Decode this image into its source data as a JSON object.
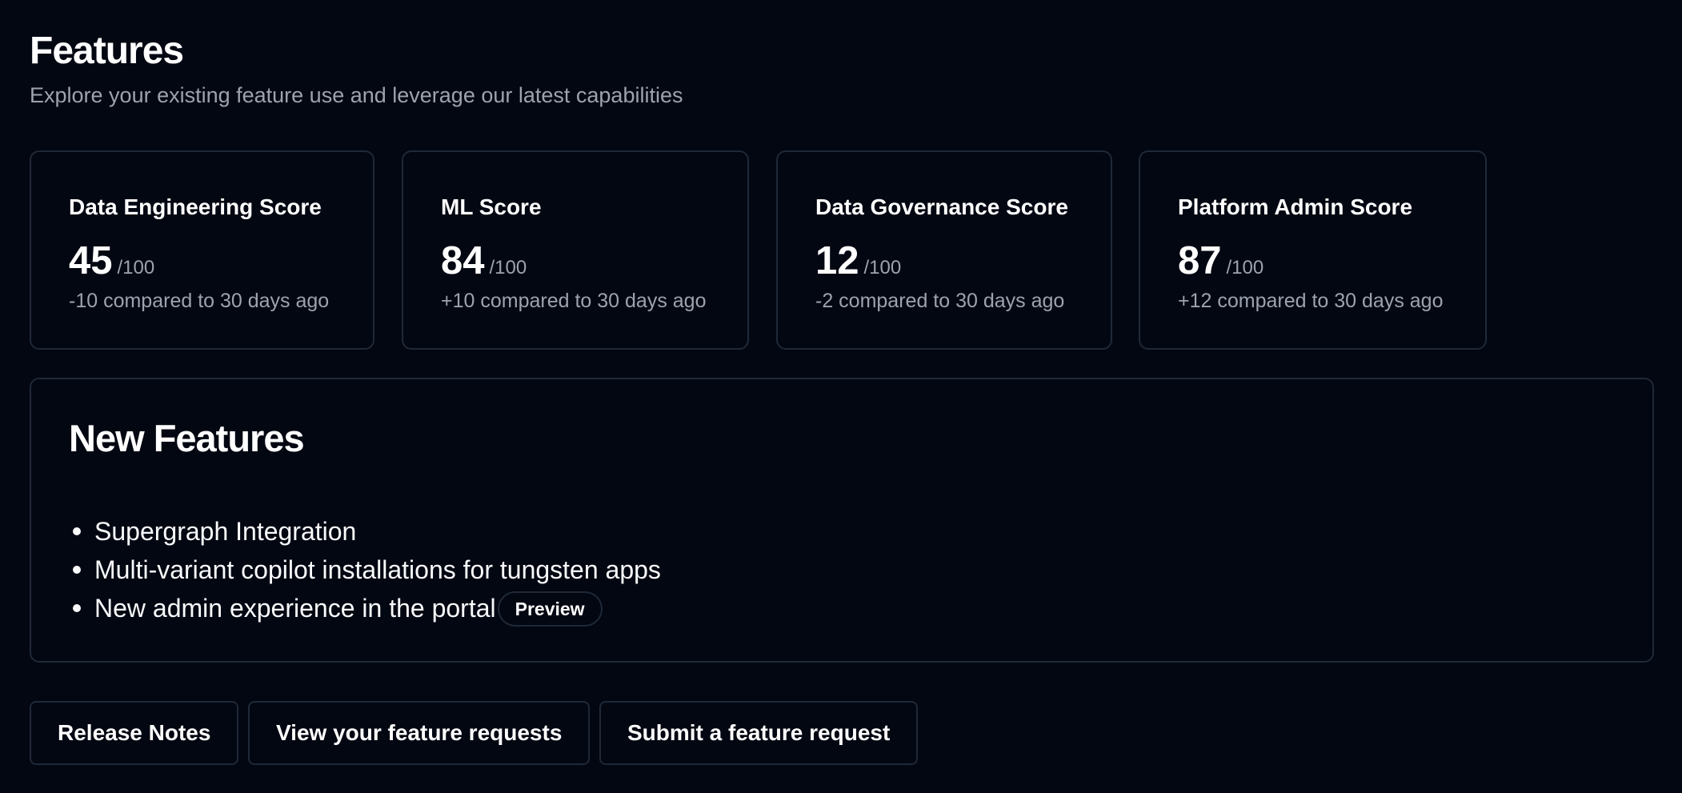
{
  "header": {
    "title": "Features",
    "subtitle": "Explore your existing feature use and leverage our latest capabilities"
  },
  "scores": [
    {
      "title": "Data Engineering Score",
      "value": "45",
      "max": "/100",
      "delta": "-10 compared to 30 days ago"
    },
    {
      "title": "ML Score",
      "value": "84",
      "max": "/100",
      "delta": "+10 compared to 30 days ago"
    },
    {
      "title": "Data Governance Score",
      "value": "12",
      "max": "/100",
      "delta": "-2 compared to 30 days ago"
    },
    {
      "title": "Platform Admin Score",
      "value": "87",
      "max": "/100",
      "delta": "+12 compared to 30 days ago"
    }
  ],
  "new_features": {
    "title": "New Features",
    "items": [
      {
        "label": "Supergraph Integration"
      },
      {
        "label": "Multi-variant copilot installations for tungsten apps"
      },
      {
        "label": "New admin experience in the portal",
        "badge": "Preview"
      }
    ]
  },
  "actions": {
    "release_notes": "Release Notes",
    "view_requests": "View your feature requests",
    "submit_request": "Submit a feature request"
  },
  "colors": {
    "background": "#030712",
    "border": "#1f2937",
    "muted_text": "#9ca3af",
    "text": "#ffffff"
  }
}
